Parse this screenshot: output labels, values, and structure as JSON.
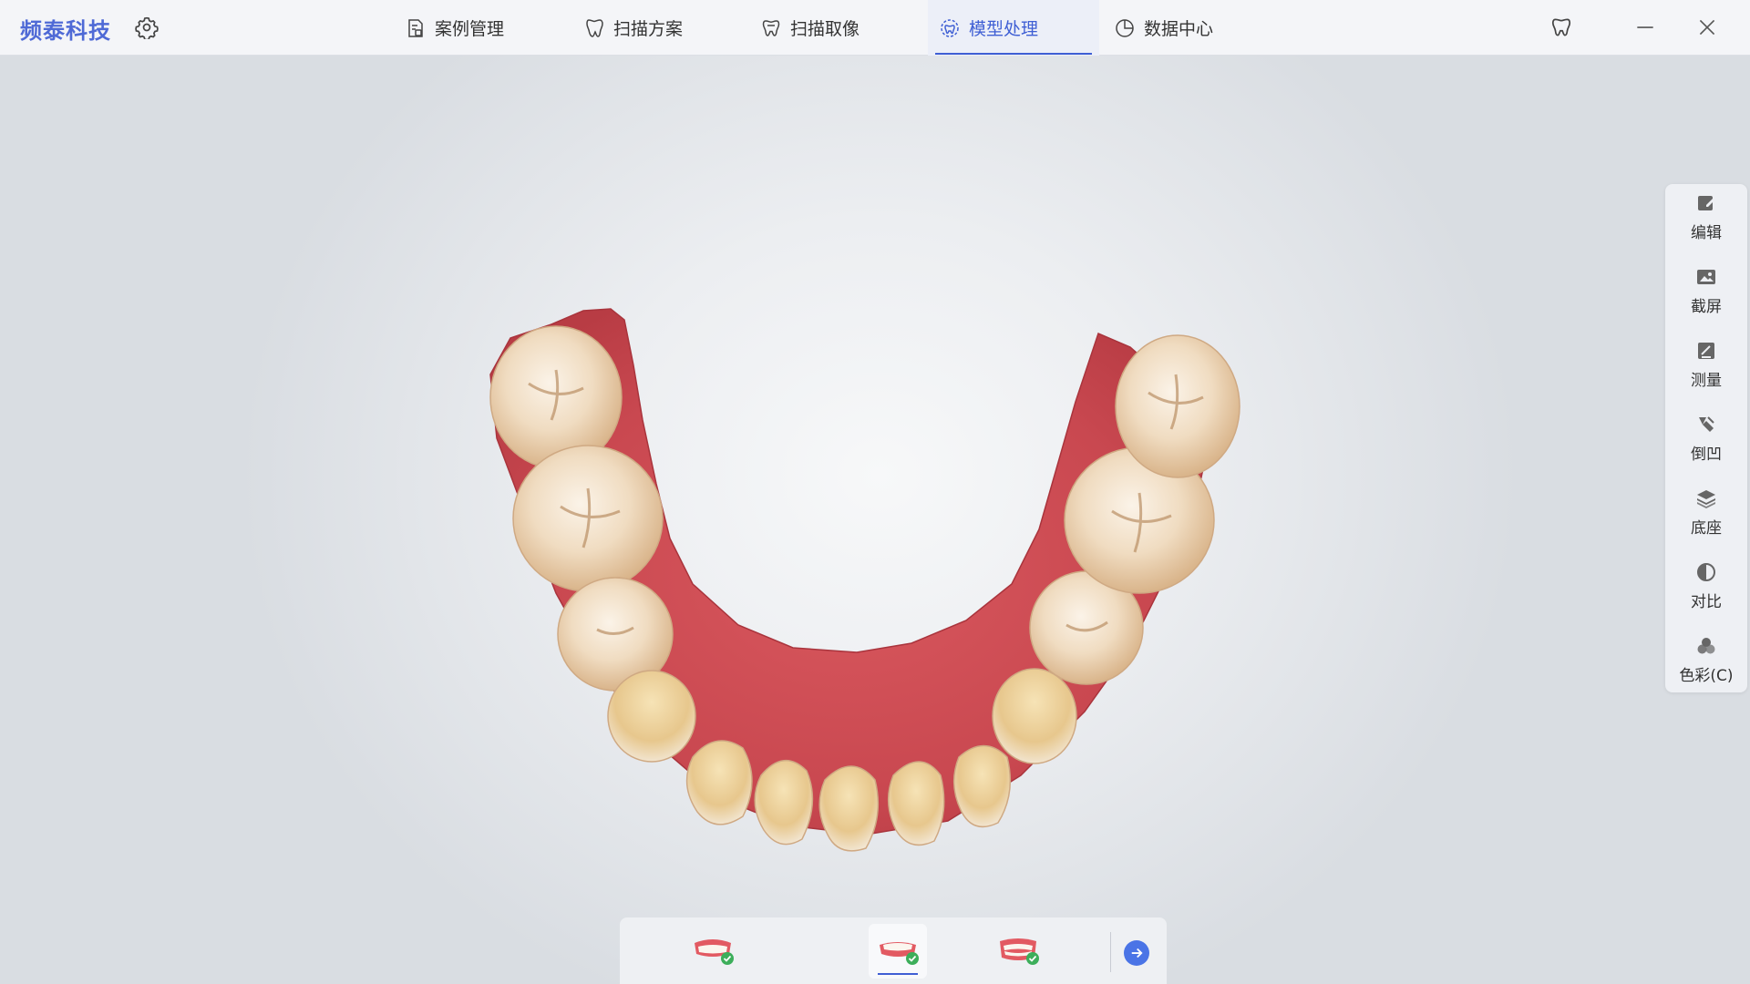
{
  "app": {
    "brand": "频泰科技",
    "accent_color": "#3f5fd4",
    "icons": {
      "settings": "gear-icon",
      "tooth": "tooth-icon",
      "minimize": "minimize-icon",
      "close": "close-icon"
    }
  },
  "nav": {
    "tabs": [
      {
        "label": "案例管理",
        "icon": "case-list-icon",
        "active": false
      },
      {
        "label": "扫描方案",
        "icon": "tooth-plan-icon",
        "active": false
      },
      {
        "label": "扫描取像",
        "icon": "tooth-scan-icon",
        "active": false
      },
      {
        "label": "模型处理",
        "icon": "model-process-icon",
        "active": true
      },
      {
        "label": "数据中心",
        "icon": "pie-chart-icon",
        "active": false
      }
    ]
  },
  "tools": [
    {
      "label": "编辑",
      "icon": "edit-icon"
    },
    {
      "label": "截屏",
      "icon": "screenshot-icon"
    },
    {
      "label": "测量",
      "icon": "measure-icon"
    },
    {
      "label": "倒凹",
      "icon": "undercut-icon"
    },
    {
      "label": "底座",
      "icon": "base-layers-icon"
    },
    {
      "label": "对比",
      "icon": "contrast-icon"
    },
    {
      "label": "色彩(C)",
      "icon": "color-icon"
    }
  ],
  "jaw_selector": {
    "items": [
      {
        "name": "upper-jaw",
        "icon": "upper-jaw-icon",
        "done": true,
        "active": false
      },
      {
        "name": "lower-jaw",
        "icon": "lower-jaw-icon",
        "done": true,
        "active": true
      },
      {
        "name": "bite",
        "icon": "bite-icon",
        "done": true,
        "active": false
      }
    ],
    "next_icon": "arrow-right-icon"
  }
}
